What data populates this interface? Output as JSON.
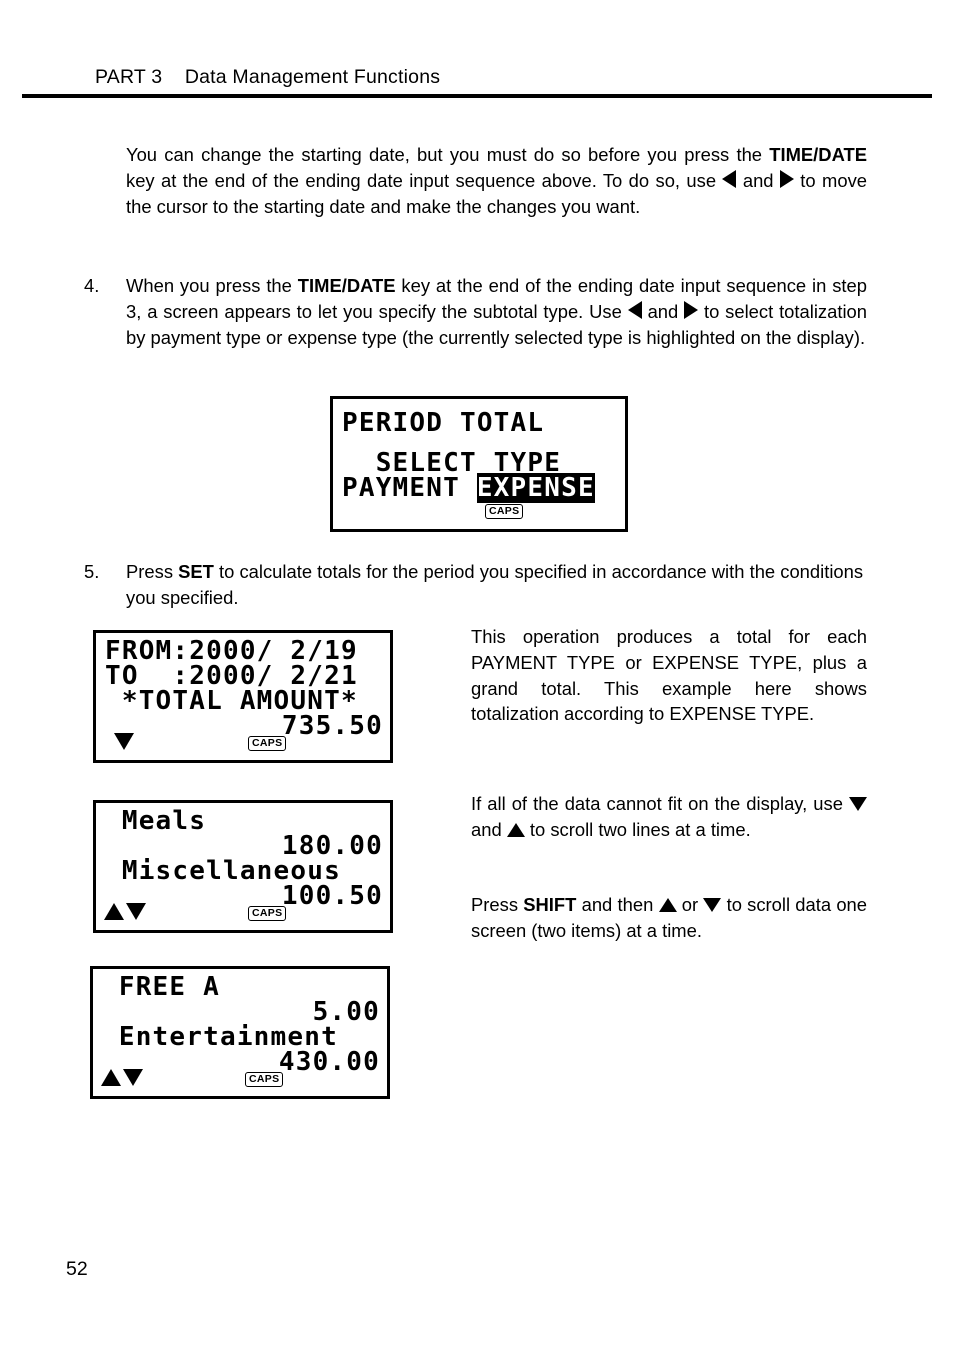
{
  "header": {
    "part": "PART 3",
    "title": "Data Management Functions"
  },
  "folio": "52",
  "intro": {
    "t1": "You can change the starting date, but you must do so before you press the ",
    "b1": "TIME/DATE",
    "t2": " key at the end of the ending date input sequence above.  To do so, use ",
    "t3": " and ",
    "t4": " to move the cursor to the starting date and make the changes you want."
  },
  "step4": {
    "number": "4.",
    "t1": "When you press the ",
    "b1": "TIME/DATE",
    "t2": " key at the end of the ending date input sequence in step 3, a screen appears to let you specify the subtotal type. Use ",
    "t3": " and ",
    "t4": " to select totalization by payment type or expense type (the currently selected type is highlighted on the display)."
  },
  "step5": {
    "number": "5.",
    "t1": "Press ",
    "b1": "SET",
    "t2": " to calculate totals for the period you specified in accordance with the conditions you specified."
  },
  "right_notes": {
    "note1": "This operation produces a total for each PAYMENT TYPE or EXPENSE TYPE, plus a grand total. This example here shows totalization according to EXPENSE TYPE.",
    "note2_t1": "If all of the data cannot fit on the display, use ",
    "note2_t2": " and ",
    "note2_t3": " to scroll two lines at a time.",
    "note3_t1": "Press ",
    "note3_b1": "SHIFT",
    "note3_t2": " and then ",
    "note3_t3": " or ",
    "note3_t4": " to scroll data one screen (two items) at a time."
  },
  "screens": {
    "period_total": {
      "line1": "PERIOD TOTAL",
      "line2": "  SELECT TYPE",
      "line3_normal": "PAYMENT ",
      "line3_highlight": "EXPENSE",
      "caps": "CAPS"
    },
    "total_amount": {
      "line1": "FROM:2000/ 2/19",
      "line2": "TO  :2000/ 2/21",
      "line3": " *TOTAL AMOUNT*",
      "line4": "735.50",
      "caps": "CAPS",
      "scroll_indicator": "down"
    },
    "meals": {
      "line1": " Meals",
      "line2": "180.00",
      "line3": " Miscellaneous",
      "line4": "100.50",
      "caps": "CAPS",
      "scroll_indicator": "up-down"
    },
    "free_a": {
      "line1": " FREE A",
      "line2": "5.00",
      "line3": " Entertainment",
      "line4": "430.00",
      "caps": "CAPS",
      "scroll_indicator": "up-down"
    }
  }
}
